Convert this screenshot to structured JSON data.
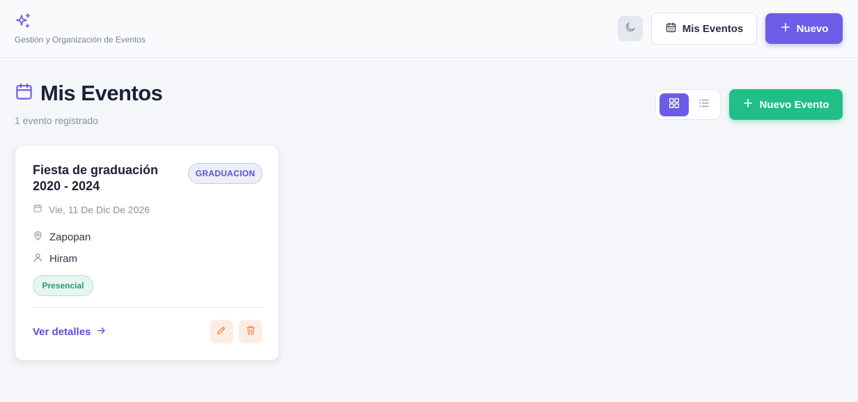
{
  "app": {
    "subtitle": "Gestión y Organización de Eventos",
    "brand_icon": "sparkles-icon"
  },
  "header": {
    "theme_icon": "moon-icon",
    "nav_label": "Mis Eventos",
    "new_label": "Nuevo"
  },
  "page": {
    "title": "Mis Eventos",
    "subtitle": "1 evento registrado",
    "view_modes": [
      "grid",
      "list"
    ],
    "active_view": "grid",
    "new_event_label": "Nuevo Evento"
  },
  "events": [
    {
      "title": "Fiesta de graduación 2020 - 2024",
      "category": "GRADUACION",
      "date": "Vie, 11 De Dic De 2026",
      "location": "Zapopan",
      "organizer": "Hiram",
      "mode": "Presencial",
      "details_label": "Ver detalles"
    }
  ],
  "colors": {
    "accent": "#6c5ce7",
    "success": "#1fbf86",
    "danger_bg": "#fdeee4",
    "danger": "#f08a4b"
  }
}
